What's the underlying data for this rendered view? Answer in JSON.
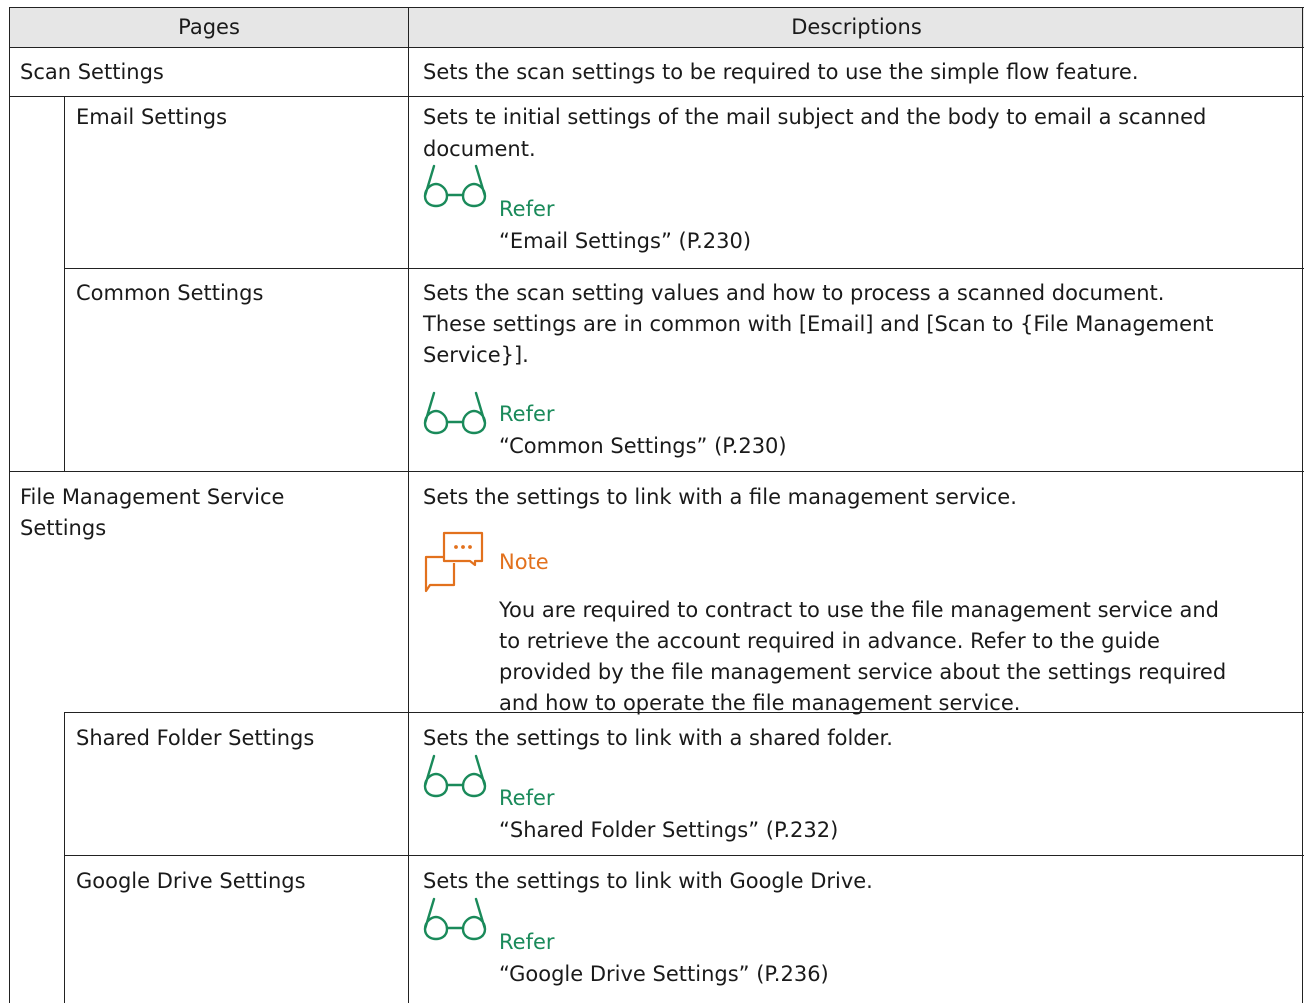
{
  "table": {
    "headers": {
      "pages": "Pages",
      "descriptions": "Descriptions"
    },
    "rows": [
      {
        "page": "Scan Settings",
        "description": "Sets the scan settings to be required to use the simple flow feature."
      },
      {
        "page": "Email Settings",
        "description": [
          "Sets te initial settings of the mail subject and the body to email a scanned",
          "document."
        ],
        "refer": {
          "label": "Refer",
          "link": "“Email Settings” (P.230)"
        }
      },
      {
        "page": "Common Settings",
        "description": [
          "Sets the scan setting values and how to process a scanned document.",
          "These settings are in common with [Email] and [Scan to {File Management",
          "Service}]."
        ],
        "refer": {
          "label": "Refer",
          "link": "“Common Settings” (P.230)"
        }
      },
      {
        "page": [
          "File Management Service",
          "Settings"
        ],
        "description": "Sets the settings to link with a file management service.",
        "note": {
          "label": "Note",
          "lines": [
            "You are required to contract to use the file management service and",
            "to retrieve the account required in advance. Refer to the guide",
            "provided by the file management service about the settings required",
            "and how to operate the file management service."
          ]
        }
      },
      {
        "page": "Shared Folder Settings",
        "description": "Sets the settings to link with a shared folder.",
        "refer": {
          "label": "Refer",
          "link": "“Shared Folder Settings” (P.232)"
        }
      },
      {
        "page": "Google Drive Settings",
        "description": "Sets the settings to link with Google Drive.",
        "refer": {
          "label": "Refer",
          "link": "“Google Drive Settings” (P.236)"
        }
      }
    ]
  },
  "colors": {
    "refer": "#1a8a5a",
    "note": "#e2711d",
    "header_bg": "#e6e6e6",
    "border": "#222222"
  },
  "icons": {
    "refer": "glasses-icon",
    "note": "chat-bubbles-icon"
  }
}
